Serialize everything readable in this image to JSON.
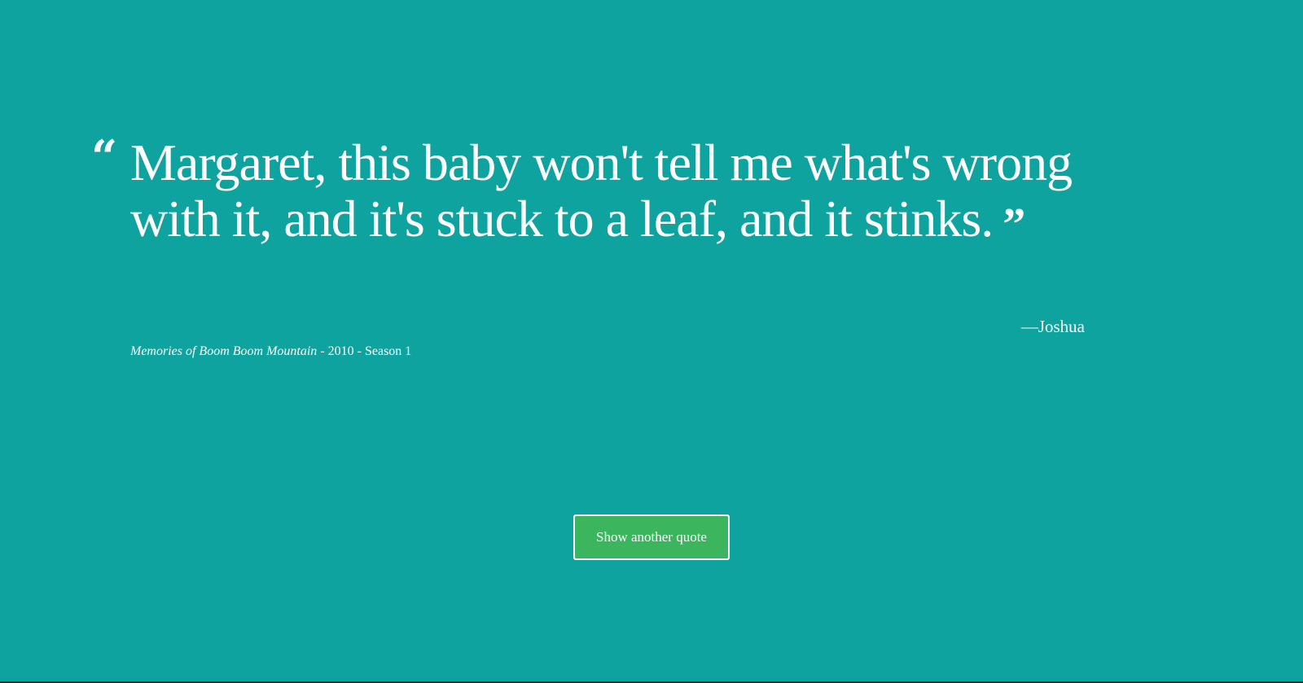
{
  "quote": {
    "open_mark": "“",
    "text": "Margaret, this baby won't tell me what's wrong with it, and it's stuck to a leaf, and it stinks.",
    "close_mark": "”",
    "author": "—Joshua"
  },
  "source": {
    "show_title": "Memories of Boom Boom Mountain",
    "details": " - 2010 - Season 1"
  },
  "actions": {
    "show_another_label": "Show another quote"
  },
  "colors": {
    "background": "#0fa3a0",
    "button": "#3bb55e",
    "text": "#ffffff"
  }
}
